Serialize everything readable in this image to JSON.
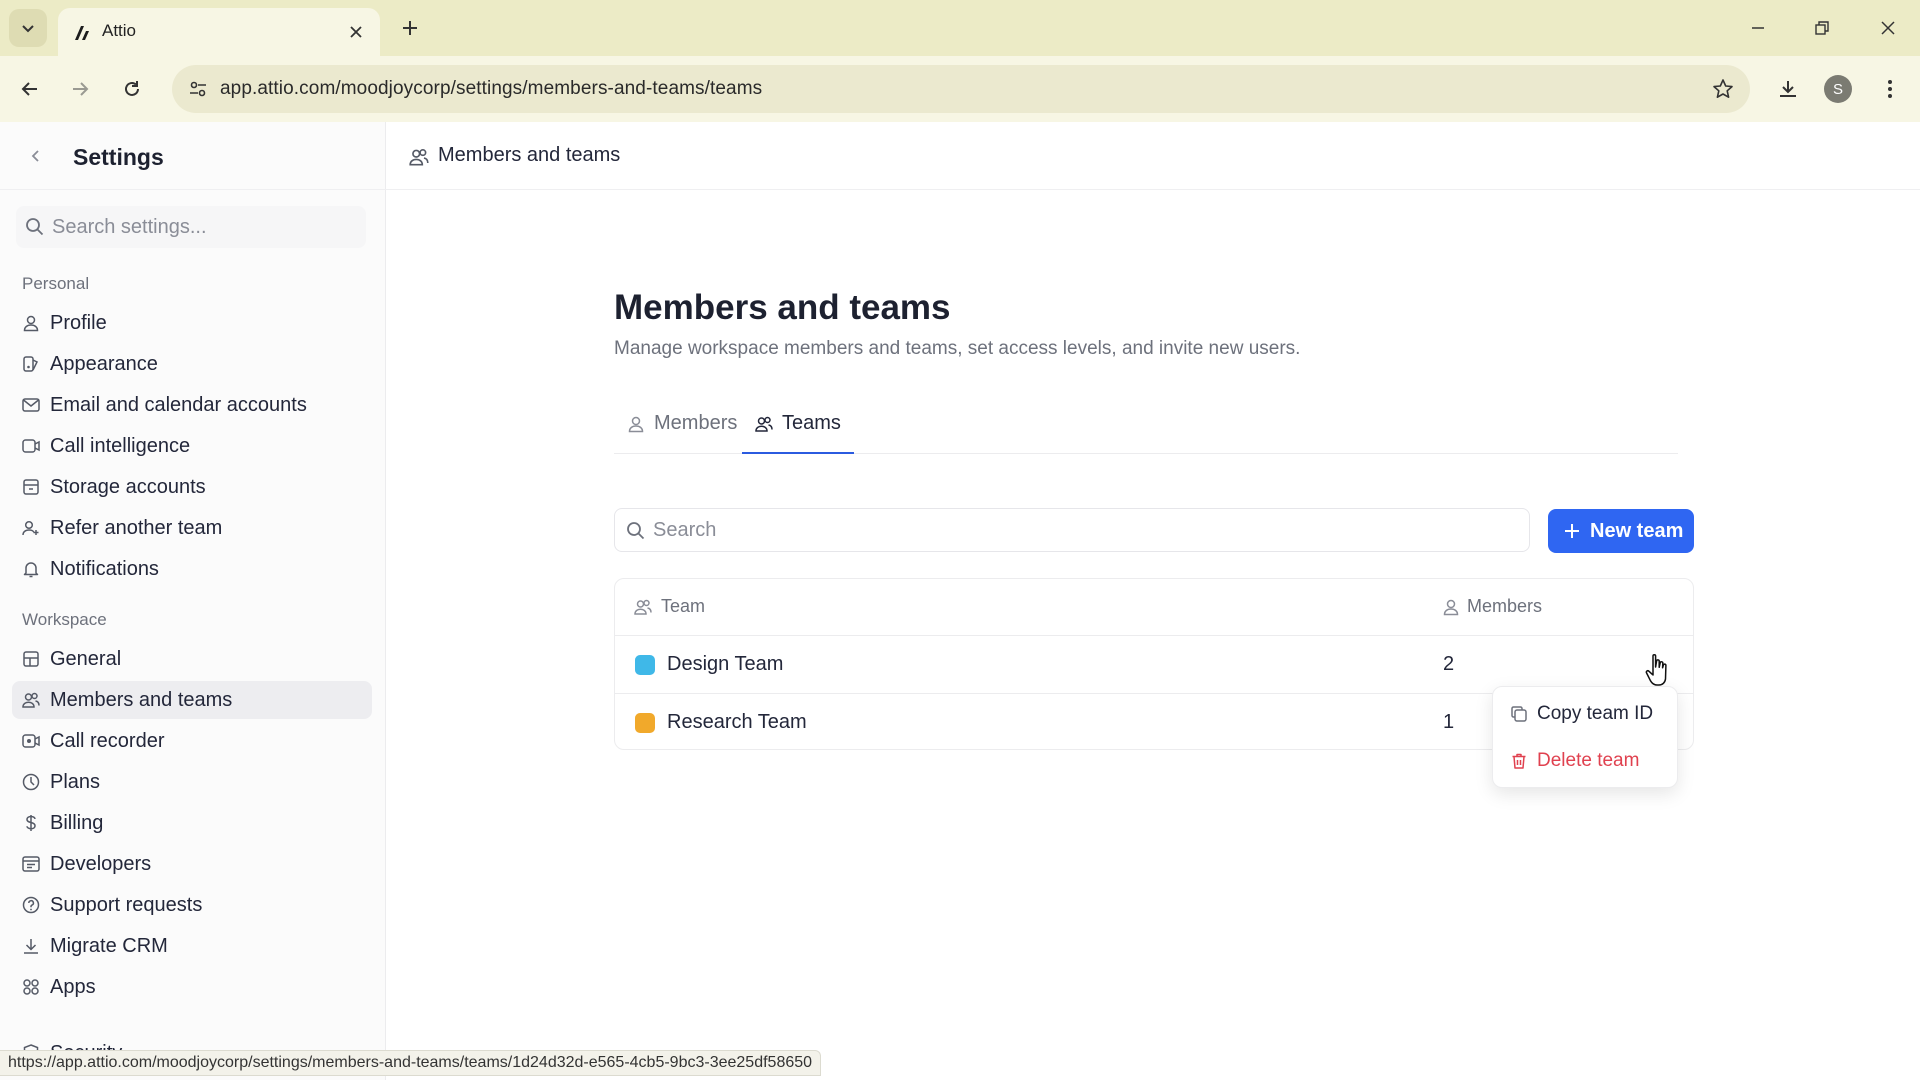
{
  "browser": {
    "tab_title": "Attio",
    "url": "app.attio.com/moodjoycorp/settings/members-and-teams/teams",
    "status_url": "https://app.attio.com/moodjoycorp/settings/members-and-teams/teams/1d24d32d-e565-4cb5-9bc3-3ee25df58650",
    "profile_initial": "S",
    "colors": {
      "frame": "#ecebc6",
      "toolbar": "#f7f6e4",
      "omnibox": "#ebe9cf"
    }
  },
  "sidebar": {
    "title": "Settings",
    "search_placeholder": "Search settings...",
    "sections": [
      {
        "label": "Personal",
        "items": [
          {
            "label": "Profile",
            "icon": "user-icon"
          },
          {
            "label": "Appearance",
            "icon": "palette-icon"
          },
          {
            "label": "Email and calendar accounts",
            "icon": "mail-icon"
          },
          {
            "label": "Call intelligence",
            "icon": "video-icon"
          },
          {
            "label": "Storage accounts",
            "icon": "storage-icon"
          },
          {
            "label": "Refer another team",
            "icon": "user-plus-icon"
          },
          {
            "label": "Notifications",
            "icon": "bell-icon"
          }
        ]
      },
      {
        "label": "Workspace",
        "items": [
          {
            "label": "General",
            "icon": "grid-icon"
          },
          {
            "label": "Members and teams",
            "icon": "users-icon",
            "active": true
          },
          {
            "label": "Call recorder",
            "icon": "call-recorder-icon"
          },
          {
            "label": "Plans",
            "icon": "plans-icon"
          },
          {
            "label": "Billing",
            "icon": "dollar-icon"
          },
          {
            "label": "Developers",
            "icon": "code-window-icon"
          },
          {
            "label": "Support requests",
            "icon": "help-circle-icon"
          },
          {
            "label": "Migrate CRM",
            "icon": "download-icon"
          },
          {
            "label": "Apps",
            "icon": "apps-icon"
          },
          {
            "label": "Security",
            "icon": "shield-icon"
          }
        ]
      }
    ]
  },
  "main": {
    "header_title": "Members and teams",
    "page_title": "Members and teams",
    "page_subtitle": "Manage workspace members and teams, set access levels, and invite new users.",
    "tabs": [
      {
        "label": "Members",
        "icon": "user-icon",
        "active": false
      },
      {
        "label": "Teams",
        "icon": "users-icon",
        "active": true
      }
    ],
    "search_placeholder": "Search",
    "new_team_label": "New team",
    "accent_color": "#2f66f2",
    "table": {
      "columns": [
        {
          "label": "Team",
          "icon": "users-icon"
        },
        {
          "label": "Members",
          "icon": "user-icon"
        }
      ],
      "rows": [
        {
          "name": "Design Team",
          "members": "2",
          "icon_color": "#3fb8e8"
        },
        {
          "name": "Research Team",
          "members": "1",
          "icon_color": "#f1a92b"
        }
      ]
    },
    "context_menu": {
      "items": [
        {
          "label": "Copy team ID",
          "icon": "copy-icon",
          "color": "#23273a"
        },
        {
          "label": "Delete team",
          "icon": "trash-icon",
          "color": "#e0414f"
        }
      ]
    }
  }
}
